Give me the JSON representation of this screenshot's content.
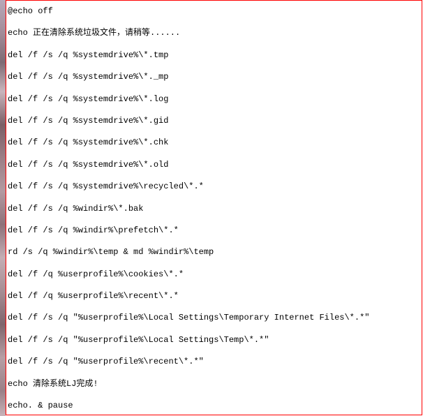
{
  "code": {
    "lines": [
      "@echo off",
      "echo 正在清除系统垃圾文件，请稍等......",
      "del /f /s /q %systemdrive%\\*.tmp",
      "del /f /s /q %systemdrive%\\*._mp",
      "del /f /s /q %systemdrive%\\*.log",
      "del /f /s /q %systemdrive%\\*.gid",
      "del /f /s /q %systemdrive%\\*.chk",
      "del /f /s /q %systemdrive%\\*.old",
      "del /f /s /q %systemdrive%\\recycled\\*.*",
      "del /f /s /q %windir%\\*.bak",
      "del /f /s /q %windir%\\prefetch\\*.*",
      "rd /s /q %windir%\\temp & md %windir%\\temp",
      "del /f /q %userprofile%\\cookies\\*.*",
      "del /f /q %userprofile%\\recent\\*.*",
      "del /f /s /q \"%userprofile%\\Local Settings\\Temporary Internet Files\\*.*\"",
      "del /f /s /q \"%userprofile%\\Local Settings\\Temp\\*.*\"",
      "del /f /s /q \"%userprofile%\\recent\\*.*\"",
      "echo 清除系统LJ完成!",
      "echo. & pause"
    ]
  }
}
